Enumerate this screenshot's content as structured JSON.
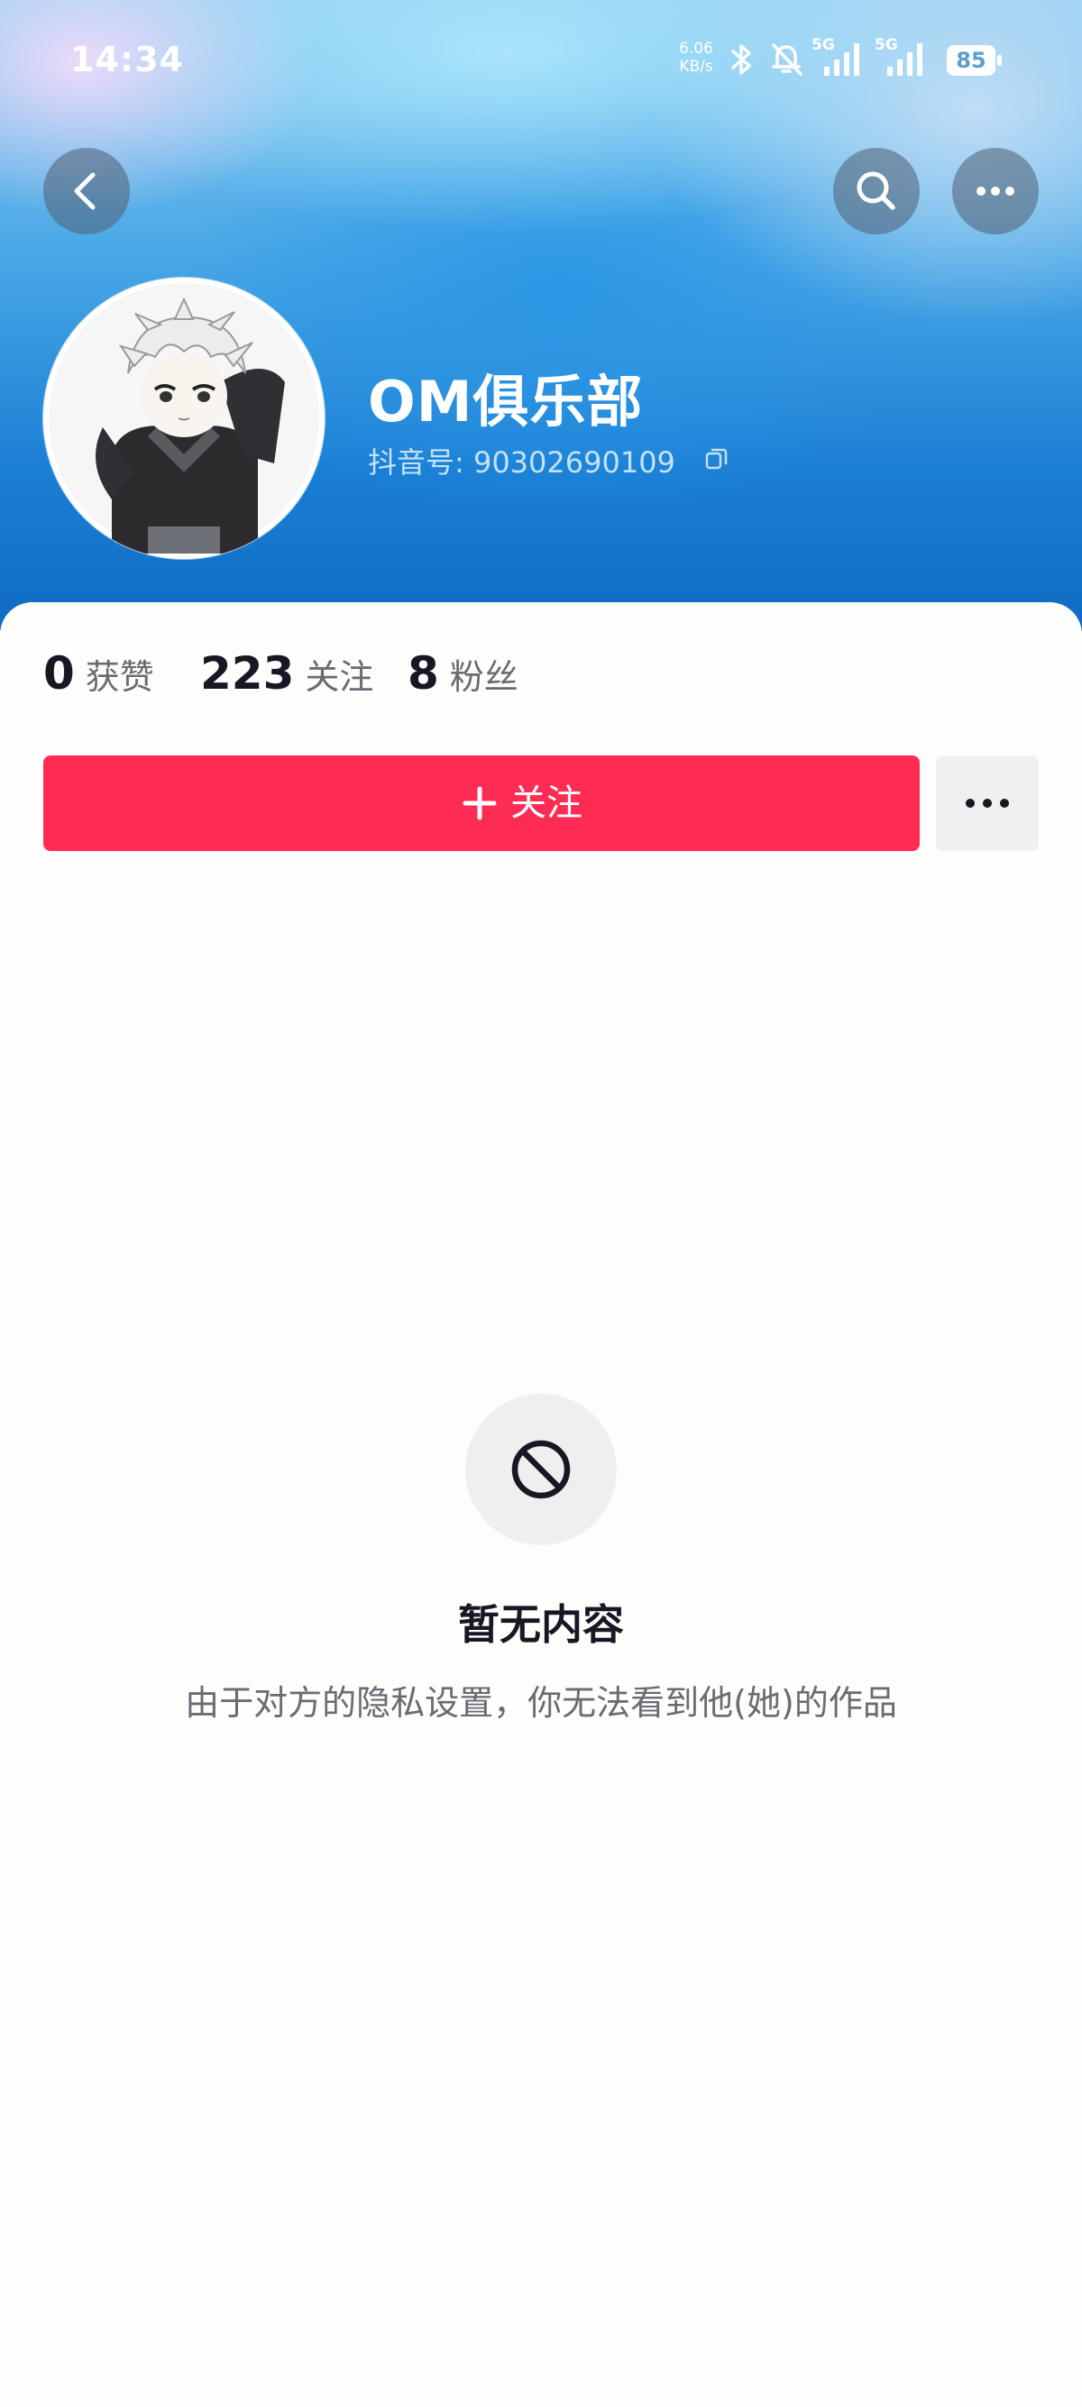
{
  "status_bar": {
    "time": "14:34",
    "net_speed_value": "6.06",
    "net_speed_unit": "KB/s",
    "signal_1_label": "5G",
    "signal_2_label": "5G",
    "battery_level": "85",
    "icons": [
      "bluetooth-icon",
      "bell-muted-icon",
      "signal-icon",
      "signal-icon",
      "battery-icon"
    ]
  },
  "nav": {
    "back_icon": "chevron-left-icon",
    "search_icon": "search-icon",
    "more_icon": "more-horizontal-icon"
  },
  "profile": {
    "nickname": "OM俱乐部",
    "douyin_id": "抖音号: 90302690109",
    "copy_icon": "copy-icon",
    "avatar": "anime-character-avatar"
  },
  "stats": [
    {
      "value": "0",
      "label": "获赞"
    },
    {
      "value": "223",
      "label": "关注"
    },
    {
      "value": "8",
      "label": "粉丝"
    }
  ],
  "actions": {
    "follow_label": "关注",
    "follow_icon": "plus-icon",
    "more_icon": "more-horizontal-icon"
  },
  "empty_state": {
    "icon": "prohibited-icon",
    "title": "暂无内容",
    "description": "由于对方的隐私设置，你无法看到他(她)的作品"
  },
  "colors": {
    "accent": "#fe2c55",
    "text_primary": "#161823",
    "text_secondary": "#6a6b73"
  }
}
